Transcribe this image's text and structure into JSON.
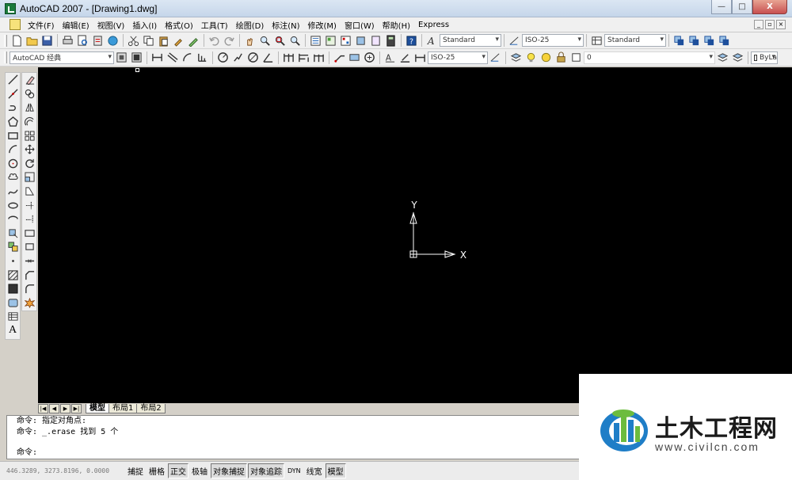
{
  "window": {
    "title": "AutoCAD 2007 - [Drawing1.dwg]",
    "controls": {
      "minimize": "—",
      "maximize": "□",
      "close": "X"
    }
  },
  "menubar": {
    "items": [
      "文件(F)",
      "编辑(E)",
      "视图(V)",
      "插入(I)",
      "格式(O)",
      "工具(T)",
      "绘图(D)",
      "标注(N)",
      "修改(M)",
      "窗口(W)",
      "帮助(H)",
      "Express"
    ],
    "mdi_controls": [
      "_",
      "▫",
      "×"
    ]
  },
  "toolbar1": {
    "text_style": "Standard",
    "dim_style": "ISO-25",
    "table_style": "Standard"
  },
  "toolbar2": {
    "workspace": "AutoCAD 经典",
    "dim_style": "ISO-25",
    "layer": "0",
    "linetype": "ByLa"
  },
  "left_palette": {
    "text_tool": "A"
  },
  "canvas": {
    "background": "#000000",
    "ucs": {
      "x_label": "X",
      "y_label": "Y"
    }
  },
  "layout_tabs": {
    "nav": [
      "|◀",
      "◀",
      "▶",
      "▶|"
    ],
    "tabs": [
      "模型",
      "布局1",
      "布局2"
    ]
  },
  "command_window": {
    "lines": [
      "命令: 指定对角点:",
      "命令: _.erase 找到 5 个",
      "命令:"
    ]
  },
  "statusbar": {
    "coords": "446.3289, 3273.8196, 0.0000",
    "buttons": [
      {
        "label": "捕捉",
        "on": false
      },
      {
        "label": "栅格",
        "on": false
      },
      {
        "label": "正交",
        "on": true
      },
      {
        "label": "极轴",
        "on": false
      },
      {
        "label": "对象捕捉",
        "on": true
      },
      {
        "label": "对象追踪",
        "on": true
      },
      {
        "label": "DYN",
        "on": false
      },
      {
        "label": "线宽",
        "on": false
      },
      {
        "label": "模型",
        "on": true
      }
    ]
  },
  "watermark": {
    "title": "土木工程网",
    "url": "www.civilcn.com"
  }
}
